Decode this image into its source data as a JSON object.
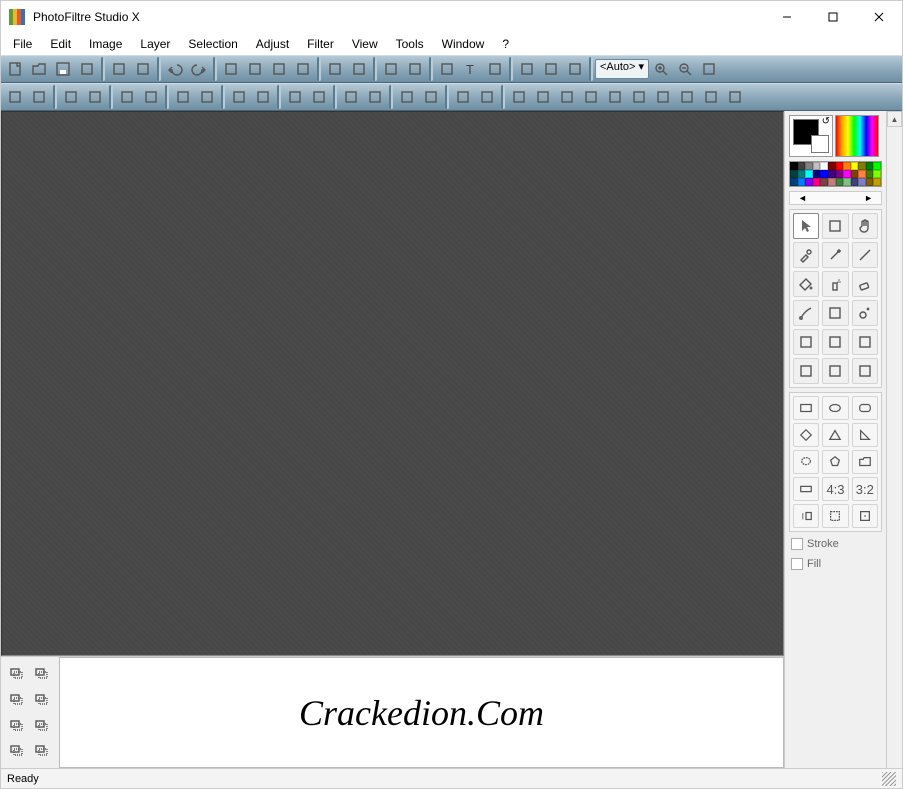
{
  "window": {
    "title": "PhotoFiltre Studio X"
  },
  "menu": {
    "items": [
      "File",
      "Edit",
      "Image",
      "Layer",
      "Selection",
      "Adjust",
      "Filter",
      "View",
      "Tools",
      "Window",
      "?"
    ]
  },
  "toolbar1": {
    "icons": [
      "new",
      "open",
      "save",
      "save-as",
      "print",
      "twain",
      "undo",
      "redo",
      "copy",
      "paste",
      "paste-special",
      "cut",
      "grid",
      "special",
      "image-manager",
      "transparency-color",
      "resize",
      "text",
      "selection-crop",
      "layer-new",
      "plugin",
      "window-fit"
    ],
    "zoom_value": "<Auto>",
    "zoom_icons": [
      "zoom-in",
      "zoom-out",
      "fit"
    ]
  },
  "toolbar2": {
    "icons": [
      "brightness-minus",
      "brightness-plus",
      "contrast-minus",
      "contrast-plus",
      "gamma-minus",
      "gamma-plus",
      "saturation-minus",
      "saturation-plus",
      "histogram",
      "auto-levels",
      "auto-contrast-minus",
      "auto-contrast-plus",
      "dither-1",
      "dither-2",
      "grayscale",
      "sepia",
      "blur",
      "sharpen",
      "soften",
      "relief",
      "emboss-1",
      "emboss-2",
      "texture",
      "gradient",
      "artistic",
      "photomask",
      "mirror-h",
      "mirror-v"
    ]
  },
  "canvas": {
    "empty": true
  },
  "layer_toolbar": {
    "icons": [
      "layers-expand",
      "layers-collapse",
      "layer-add",
      "layer-save",
      "layer-select",
      "layer-mask",
      "layer-grid",
      "layer-play"
    ]
  },
  "watermark": "Crackedion.Com",
  "right_panel": {
    "fg_color": "#000000",
    "bg_color": "#ffffff",
    "palette_nav": {
      "prev": "◄",
      "next": "►"
    },
    "palette": [
      "#000000",
      "#404040",
      "#808080",
      "#c0c0c0",
      "#ffffff",
      "#800000",
      "#ff0000",
      "#ff8000",
      "#ffff00",
      "#808000",
      "#008000",
      "#00ff00",
      "#004040",
      "#008080",
      "#00ffff",
      "#000080",
      "#0000ff",
      "#400080",
      "#800080",
      "#ff00ff",
      "#804000",
      "#ff8040",
      "#408000",
      "#80ff00",
      "#004080",
      "#0080ff",
      "#8000ff",
      "#ff0080",
      "#804040",
      "#c08080",
      "#408040",
      "#80c080",
      "#404080",
      "#8080c0",
      "#806000",
      "#c0a000"
    ],
    "tools": [
      {
        "name": "pointer",
        "sel": true
      },
      {
        "name": "selection-tool"
      },
      {
        "name": "hand"
      },
      {
        "name": "eyedropper"
      },
      {
        "name": "magic-wand"
      },
      {
        "name": "line"
      },
      {
        "name": "fill"
      },
      {
        "name": "spray"
      },
      {
        "name": "eraser"
      },
      {
        "name": "brush"
      },
      {
        "name": "advanced-brush"
      },
      {
        "name": "clone"
      },
      {
        "name": "blur-tool"
      },
      {
        "name": "smudge"
      },
      {
        "name": "smear"
      },
      {
        "name": "deform"
      },
      {
        "name": "retouch"
      },
      {
        "name": "art-brush"
      }
    ],
    "shapes": [
      {
        "name": "rectangle"
      },
      {
        "name": "ellipse"
      },
      {
        "name": "rounded-rect"
      },
      {
        "name": "diamond"
      },
      {
        "name": "triangle"
      },
      {
        "name": "right-triangle"
      },
      {
        "name": "lasso"
      },
      {
        "name": "polygon"
      },
      {
        "name": "folder-shape"
      },
      {
        "name": "ratio-free"
      },
      {
        "name": "ratio-43"
      },
      {
        "name": "ratio-32"
      },
      {
        "name": "invert-sel"
      },
      {
        "name": "bounds"
      },
      {
        "name": "center"
      }
    ],
    "options": {
      "stroke_label": "Stroke",
      "fill_label": "Fill",
      "stroke_checked": false,
      "fill_checked": false
    }
  },
  "status": {
    "text": "Ready"
  }
}
